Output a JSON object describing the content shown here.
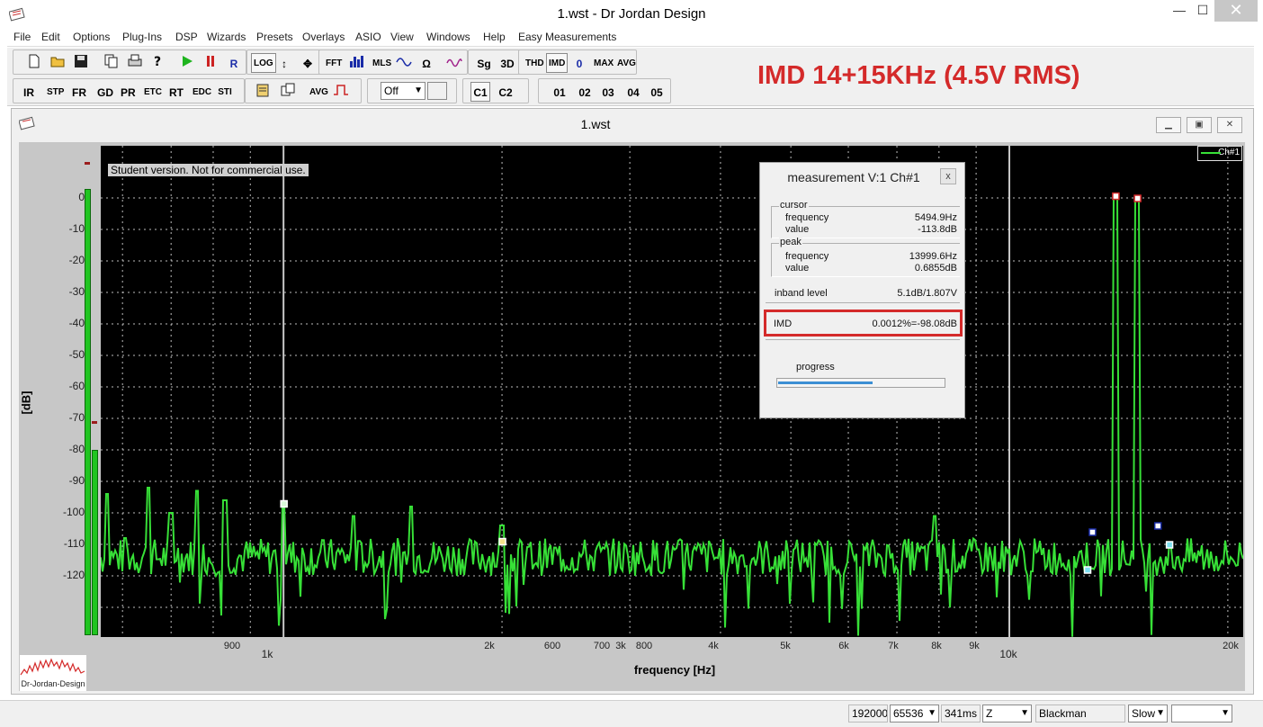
{
  "window": {
    "title": "1.wst - Dr Jordan Design",
    "min": "—",
    "max": "☐",
    "close": "✕"
  },
  "menu": [
    "File",
    "Edit",
    "Options",
    "Plug-Ins",
    "DSP",
    "Wizards",
    "Presets",
    "Overlays",
    "ASIO",
    "View",
    "Windows",
    "Help",
    "Easy Measurements"
  ],
  "toolbar": {
    "row1": [
      "LOG",
      "FFT",
      "MLS",
      "Sg",
      "3D",
      "THD",
      "IMD",
      "0",
      "MAX",
      "AVG"
    ],
    "row2": [
      "IR",
      "STP",
      "FR",
      "GD",
      "PR",
      "ETC",
      "RT",
      "EDC",
      "STI",
      "AVG"
    ],
    "off_select": "Off",
    "channels": [
      "C1",
      "C2"
    ],
    "presets": [
      "01",
      "02",
      "03",
      "04",
      "05"
    ]
  },
  "banner": "IMD 14+15KHz (4.5V RMS)",
  "document": {
    "title": "1.wst"
  },
  "graph": {
    "watermark": "Student version. Not for commercial use.",
    "ylabel": "[dB]",
    "xlabel": "frequency [Hz]",
    "yticks": [
      "0",
      "-10",
      "-20",
      "-30",
      "-40",
      "-50",
      "-60",
      "-70",
      "-80",
      "-90",
      "-100",
      "-110",
      "-120"
    ],
    "xticks_minor": [
      "600",
      "700",
      "800",
      "900",
      "2k",
      "3k",
      "4k",
      "5k",
      "6k",
      "7k",
      "8k",
      "9k",
      "20k"
    ],
    "xticks_major": [
      "1k",
      "10k"
    ],
    "legend": "Ch#1",
    "logo_text": "Dr-Jordan-Design",
    "colors": {
      "trace": "#37e037",
      "background": "#000000",
      "marker_red": "#d42a2a",
      "marker_blue": "#1a2ca8",
      "marker_cyan": "#7fe0f2",
      "marker_yellow": "#f2e08a"
    }
  },
  "measurement": {
    "title": "measurement V:1 Ch#1",
    "close": "x",
    "cursor": {
      "label": "cursor",
      "frequency_label": "frequency",
      "frequency": "5494.9Hz",
      "value_label": "value",
      "value": "-113.8dB"
    },
    "peak": {
      "label": "peak",
      "frequency_label": "frequency",
      "frequency": "13999.6Hz",
      "value_label": "value",
      "value": "0.6855dB"
    },
    "inband_label": "inband level",
    "inband": "5.1dB/1.807V",
    "imd_label": "IMD",
    "imd": "0.0012%=-98.08dB",
    "progress_label": "progress",
    "progress": 0.58
  },
  "status": {
    "samplerate": "192000",
    "fftsize": "65536",
    "time": "341ms",
    "z": "Z",
    "window": "Blackman",
    "speed": "Slow",
    "blank": ""
  }
}
